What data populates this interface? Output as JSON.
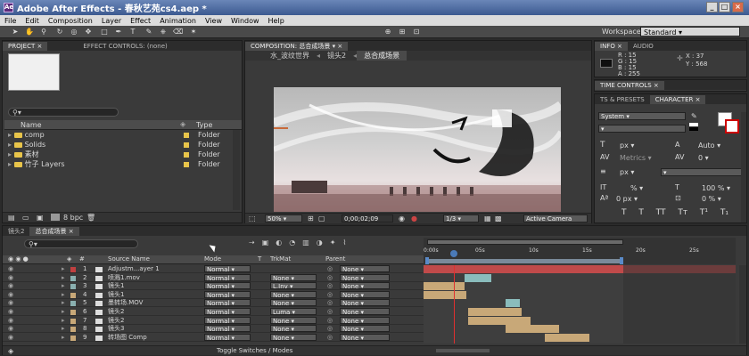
{
  "window": {
    "title": "Adobe After Effects - 春秋艺苑cs4.aep *",
    "app_icon": "Ae"
  },
  "menu": [
    "File",
    "Edit",
    "Composition",
    "Layer",
    "Effect",
    "Animation",
    "View",
    "Window",
    "Help"
  ],
  "toolbar": {
    "workspace_label": "Workspace:",
    "workspace_value": "Standard"
  },
  "project_panel": {
    "tabs": [
      "PROJECT ×",
      "EFFECT CONTROLS: (none)"
    ],
    "columns": {
      "name": "Name",
      "type": "Type"
    },
    "items": [
      {
        "name": "comp",
        "type": "Folder"
      },
      {
        "name": "Solids",
        "type": "Folder"
      },
      {
        "name": "素材",
        "type": "Folder"
      },
      {
        "name": "竹子 Layers",
        "type": "Folder"
      }
    ],
    "footer_bpc": "8 bpc"
  },
  "composition_panel": {
    "tab": "COMPOSITION: 总合成场景",
    "breadcrumbs": [
      "水_波纹世界",
      "镜头2",
      "总合成场景"
    ],
    "zoom": "50%",
    "timecode": "0;00;02;09",
    "resolution": "1/3",
    "camera": "Active Camera"
  },
  "info_panel": {
    "tabs": [
      "INFO ×",
      "AUDIO"
    ],
    "r": "R : 15",
    "g": "G : 15",
    "b": "B : 15",
    "a": "A : 255",
    "x": "X : 37",
    "y": "Y : 568"
  },
  "time_controls": {
    "tab": "TIME CONTROLS ×"
  },
  "character_panel": {
    "tabs": [
      "TS & PRESETS",
      "CHARACTER ×"
    ],
    "font": "System",
    "size_unit": "px",
    "leading": "Auto",
    "kerning": "Metrics",
    "tracking": "0",
    "stroke_unit": "px",
    "vscale": "%",
    "hscale": "100 %",
    "baseline": "0 px",
    "tsume": "0 %"
  },
  "timeline": {
    "tabs": [
      "镜头2",
      "总合成场景 ×"
    ],
    "columns": {
      "source": "Source Name",
      "mode": "Mode",
      "t": "T",
      "trkmat": "TrkMat",
      "parent": "Parent"
    },
    "ruler": [
      "0:00s",
      "05s",
      "10s",
      "15s",
      "20s",
      "25s"
    ],
    "layers": [
      {
        "num": "1",
        "name": "Adjustm...ayer 1",
        "mode": "Normal",
        "trkmat": "",
        "parent": "None",
        "color": "#c04040"
      },
      {
        "num": "2",
        "name": "喷溅1.mov",
        "mode": "Normal",
        "trkmat": "None",
        "parent": "None",
        "color": "#8ab0b0"
      },
      {
        "num": "3",
        "name": "镜头1",
        "mode": "Normal",
        "trkmat": "L.Inv",
        "parent": "None",
        "color": "#8ab0b0"
      },
      {
        "num": "4",
        "name": "镜头1",
        "mode": "Normal",
        "trkmat": "None",
        "parent": "None",
        "color": "#c8a878"
      },
      {
        "num": "5",
        "name": "墨转场.MOV",
        "mode": "Normal",
        "trkmat": "None",
        "parent": "None",
        "color": "#8ab0b0"
      },
      {
        "num": "6",
        "name": "镜头2",
        "mode": "Normal",
        "trkmat": "Luma",
        "parent": "None",
        "color": "#c8a878"
      },
      {
        "num": "7",
        "name": "镜头2",
        "mode": "Normal",
        "trkmat": "None",
        "parent": "None",
        "color": "#c8a878"
      },
      {
        "num": "8",
        "name": "镜头3",
        "mode": "Normal",
        "trkmat": "None",
        "parent": "None",
        "color": "#c8a878"
      },
      {
        "num": "9",
        "name": "转场图 Comp",
        "mode": "Normal",
        "trkmat": "None",
        "parent": "None",
        "color": "#c8a878"
      }
    ],
    "footer_toggle": "Toggle Switches / Modes"
  }
}
